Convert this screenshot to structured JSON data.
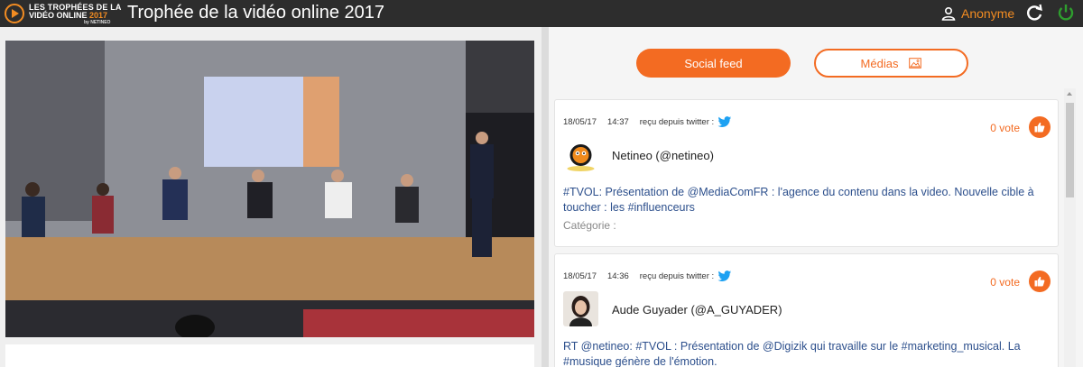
{
  "header": {
    "logo_line1": "LES TROPHÉES DE LA",
    "logo_line2_text": "VIDÉO ONLINE ",
    "logo_line2_year": "2017",
    "logo_line3": "by NETINEO",
    "title": "Trophée de la vidéo online 2017",
    "user_label": "Anonyme",
    "user_icon": "user-icon",
    "refresh_icon": "refresh-icon",
    "power_icon": "power-icon"
  },
  "colors": {
    "accent": "#f36b22",
    "topbar": "#2d2d2d",
    "power": "#2e9e2e",
    "link_text": "#2c4f8c",
    "twitter": "#1da1f2"
  },
  "tabs": {
    "social_feed": "Social feed",
    "medias": "Médias"
  },
  "feed": [
    {
      "date": "18/05/17",
      "time": "14:37",
      "source": "reçu depuis twitter :",
      "votes": "0 vote",
      "author": "Netineo (@netineo)",
      "text": "#TVOL: Présentation de @MediaComFR : l'agence du contenu dans la video. Nouvelle cible à toucher : les #influenceurs",
      "category_label": "Catégorie :"
    },
    {
      "date": "18/05/17",
      "time": "14:36",
      "source": "reçu depuis twitter :",
      "votes": "0 vote",
      "author": "Aude Guyader (@A_GUYADER)",
      "text": "RT @netineo: #TVOL : Présentation de @Digizik qui travaille sur le #marketing_musical. La #musique génère de l'émotion."
    }
  ]
}
